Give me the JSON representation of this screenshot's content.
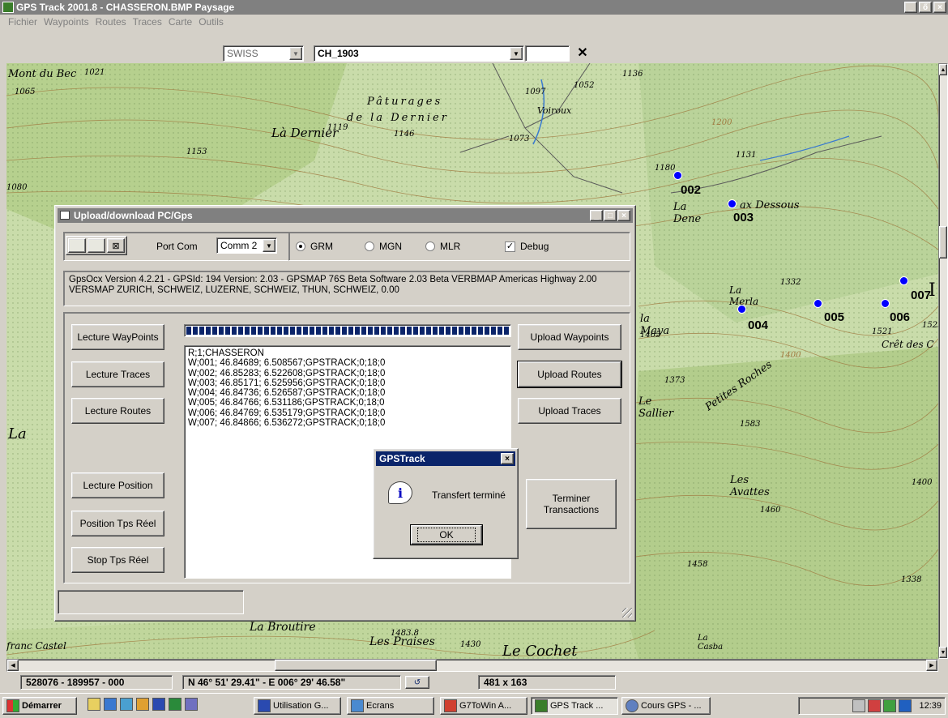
{
  "window": {
    "title": "GPS Track  2001.8 - CHASSERON.BMP Paysage",
    "min": "_",
    "restore": "ő",
    "close": "×"
  },
  "menu": [
    "Fichier",
    "Waypoints",
    "Routes",
    "Traces",
    "Carte",
    "Outils"
  ],
  "toolbar": {
    "grid": "SWISS",
    "datum": "CH_1903",
    "field": "",
    "clear": "✕"
  },
  "map": {
    "labels": [
      "Mont du Bec",
      "1021",
      "1065",
      "1080",
      "Là Dernier",
      "Pâturages",
      "1119",
      "de la Dernier",
      "1146",
      "1153",
      "Voiroux",
      "1097",
      "1052",
      "1073",
      "1136",
      "1200",
      "1180",
      "1131",
      "La Dene",
      "ax Dessous",
      "La Merla",
      "1332",
      "la Maya",
      "1465",
      "1521",
      "1525",
      "Crêt des C",
      "1373",
      "Le Sallier",
      "Petites Roches",
      "1583",
      "1400",
      "Les Avattes",
      "1460",
      "1400",
      "1458",
      "1338",
      "La Broutire",
      "1483.8",
      "franc Castel",
      "Les Praises",
      "1430",
      "Le Cochet",
      "La Casba",
      "La",
      "I"
    ],
    "waypoints": [
      "002",
      "003",
      "004",
      "005",
      "006",
      "007"
    ],
    "waypoint_color": "#0000ff"
  },
  "dialog": {
    "title": "Upload/download PC/Gps",
    "port_label": "Port Com",
    "port_value": "Comm 2",
    "protocols": [
      "GRM",
      "MGN",
      "MLR"
    ],
    "protocol_selected": "GRM",
    "debug_label": "Debug",
    "debug_checked": "✓",
    "info": "GpsOcx Version 4.2.21 -  GPSId: 194 Version: 2.03 - GPSMAP 76S Beta Software 2.03 Beta VERBMAP Americas Highway 2.00 VERSMAP ZURICH, SCHWEIZ, LUZERNE, SCHWEIZ, THUN, SCHWEIZ, 0.00",
    "left_buttons": [
      "Lecture WayPoints",
      "Lecture Traces",
      "Lecture Routes",
      "Lecture Position",
      "Position Tps Réel",
      "Stop Tps Réel"
    ],
    "right_buttons": [
      "Upload Waypoints",
      "Upload Routes",
      "Upload Traces"
    ],
    "terminate_label": "Terminer Transactions",
    "progress": 1.0,
    "log": [
      "R;1;CHASSERON",
      "W;001; 46.84689; 6.508567;GPSTRACK;0;18;0",
      "W;002; 46.85283; 6.522608;GPSTRACK;0;18;0",
      "W;003; 46.85171; 6.525956;GPSTRACK;0;18;0",
      "W;004; 46.84736; 6.526587;GPSTRACK;0;18;0",
      "W;005; 46.84766; 6.531186;GPSTRACK;0;18;0",
      "W;006; 46.84769; 6.535179;GPSTRACK;0;18;0",
      "W;007; 46.84866; 6.536272;GPSTRACK;0;18;0"
    ],
    "status": ""
  },
  "msgbox": {
    "title": "GPSTrack",
    "message": "Transfert terminé",
    "ok": "OK",
    "close": "×"
  },
  "statusbar": {
    "coords": "528076 - 189957 - 000",
    "latlon": "N 46° 51' 29.41\" - E 006° 29' 46.58\"",
    "size": "481 x 163"
  },
  "taskbar": {
    "start": "Démarrer",
    "tasks": [
      "Utilisation G...",
      "Ecrans",
      "G7ToWin A...",
      "GPS Track ...",
      "Cours GPS - ..."
    ],
    "clock": "12:39"
  }
}
